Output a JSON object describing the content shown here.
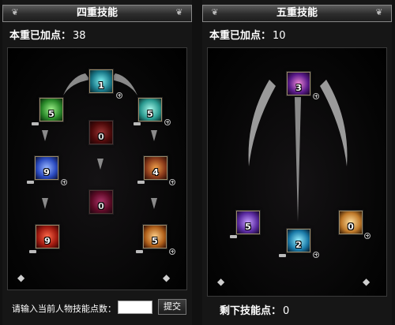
{
  "left_panel": {
    "title": "四重技能",
    "points_label": "本重已加点：",
    "points_value": "38",
    "skills": [
      {
        "id": "s1",
        "level": "1",
        "color": "#2aa7b8"
      },
      {
        "id": "s2",
        "level": "5",
        "color": "#2f9b3a"
      },
      {
        "id": "s3",
        "level": "5",
        "color": "#2bb0a8"
      },
      {
        "id": "s4",
        "level": "0",
        "color": "#8a1a1a"
      },
      {
        "id": "s5",
        "level": "9",
        "color": "#2d4fc6"
      },
      {
        "id": "s6",
        "level": "4",
        "color": "#c8561a"
      },
      {
        "id": "s7",
        "level": "0",
        "color": "#8a1546"
      },
      {
        "id": "s8",
        "level": "9",
        "color": "#b2261d"
      },
      {
        "id": "s9",
        "level": "5",
        "color": "#d0772a"
      }
    ],
    "footer_label": "请输入当前人物技能点数：",
    "footer_input_value": "",
    "submit_label": "提交"
  },
  "right_panel": {
    "title": "五重技能",
    "points_label": "本重已加点：",
    "points_value": "10",
    "skills": [
      {
        "id": "r1",
        "level": "3",
        "color": "#8a2a8f"
      },
      {
        "id": "r2",
        "level": "5",
        "color": "#6a3ac0"
      },
      {
        "id": "r3",
        "level": "2",
        "color": "#2a9ac0"
      },
      {
        "id": "r4",
        "level": "0",
        "color": "#d08a2a"
      }
    ],
    "remaining_label": "剩下技能点：",
    "remaining_value": "0"
  }
}
